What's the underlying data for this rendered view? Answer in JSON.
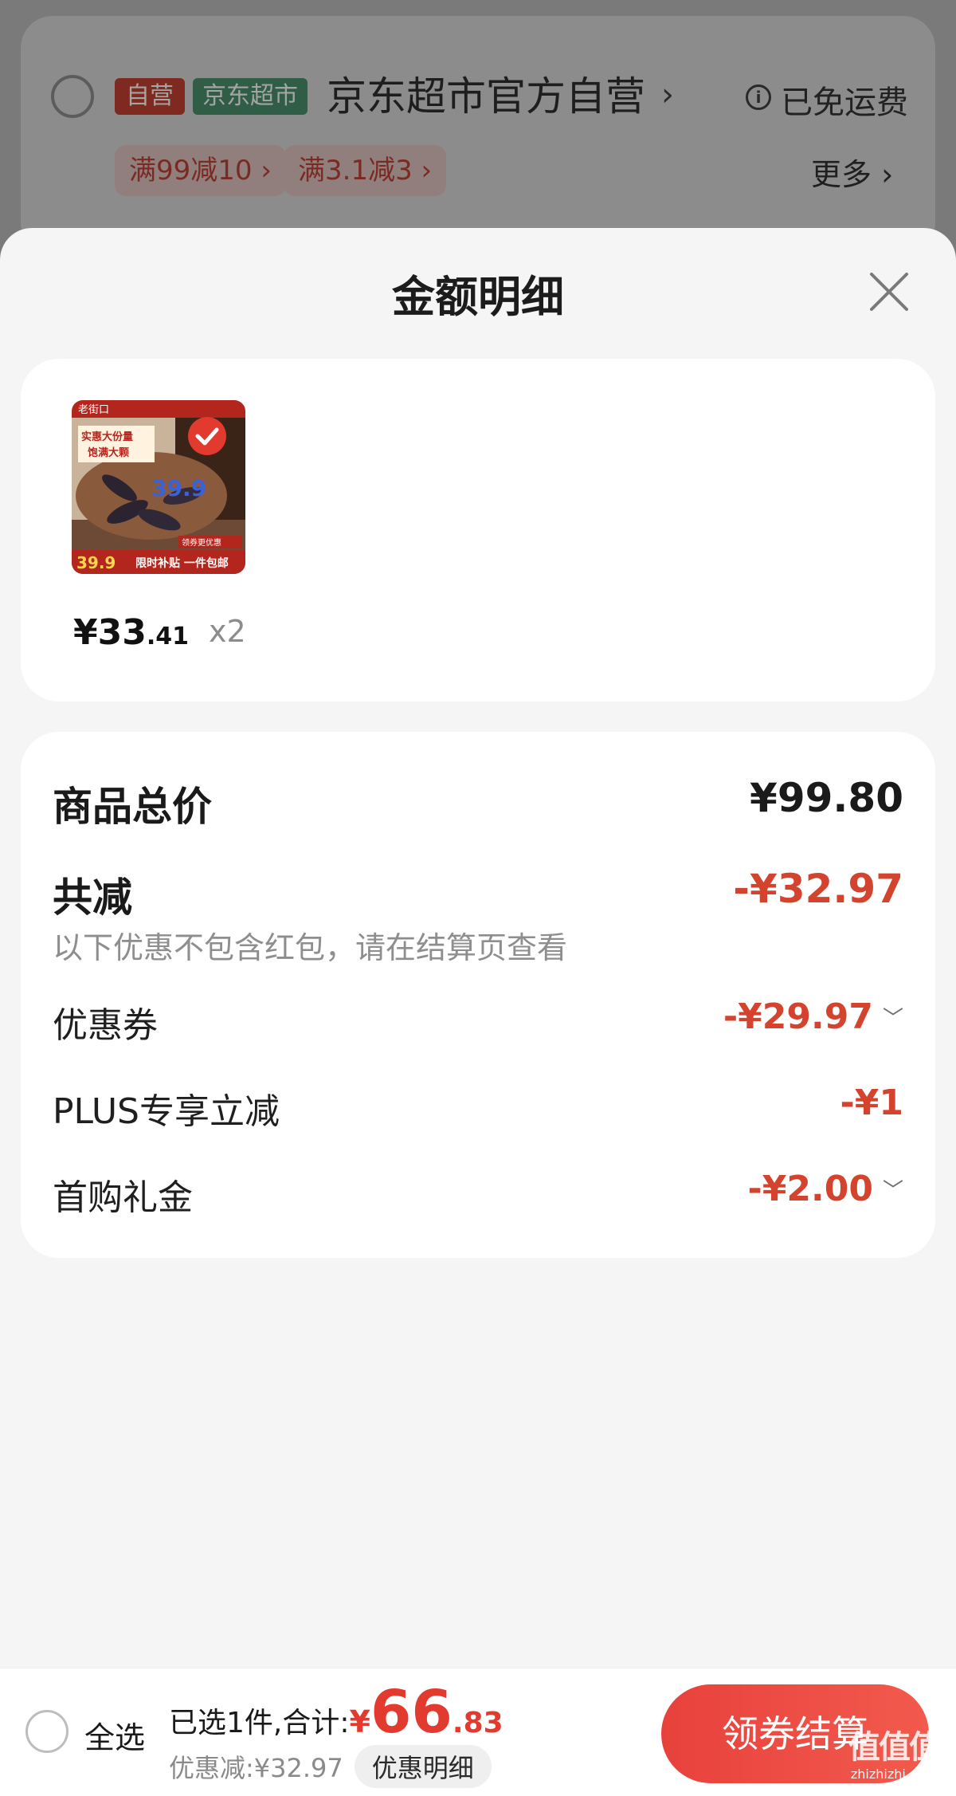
{
  "shop": {
    "tag_self": "自营",
    "tag_market": "京东超市",
    "name": "京东超市官方自营",
    "free_shipping": "已免运费",
    "promos": [
      "满99减10",
      "满3.1减3"
    ],
    "more": "更多"
  },
  "sheet": {
    "title": "金额明细"
  },
  "product": {
    "image_texts": {
      "brand": "老街口",
      "badge_line1": "实惠大份量",
      "badge_line2": "饱满大颗",
      "price_tag": "39.9",
      "coupon": "领券更优惠",
      "promo_banner": "限时补贴 一件包邮"
    },
    "price_int": "¥33",
    "price_dec": ".41",
    "qty": "x2"
  },
  "summary": {
    "goods_total_label": "商品总价",
    "goods_total_value": "¥99.80",
    "discount_label": "共减",
    "discount_value": "-¥32.97",
    "note": "以下优惠不包含红包，请在结算页查看",
    "items": [
      {
        "label": "优惠券",
        "value": "-¥29.97",
        "expandable": true
      },
      {
        "label": "PLUS专享立减",
        "value": "-¥1",
        "expandable": false
      },
      {
        "label": "首购礼金",
        "value": "-¥2.00",
        "expandable": true
      }
    ]
  },
  "bottom": {
    "select_all": "全选",
    "selected_text": "已选1件,合计:",
    "total_symbol": "¥",
    "total_int": "66",
    "total_dec": ".83",
    "discount_text": "优惠减:¥32.97",
    "detail_btn": "优惠明细",
    "checkout": "领券结算"
  },
  "watermark": {
    "logo": "值值值",
    "url": "zhizhizhi.com"
  },
  "colors": {
    "accent_red": "#d4432d",
    "checkout_red": "#e8413c",
    "sheet_bg": "#f5f5f5"
  }
}
